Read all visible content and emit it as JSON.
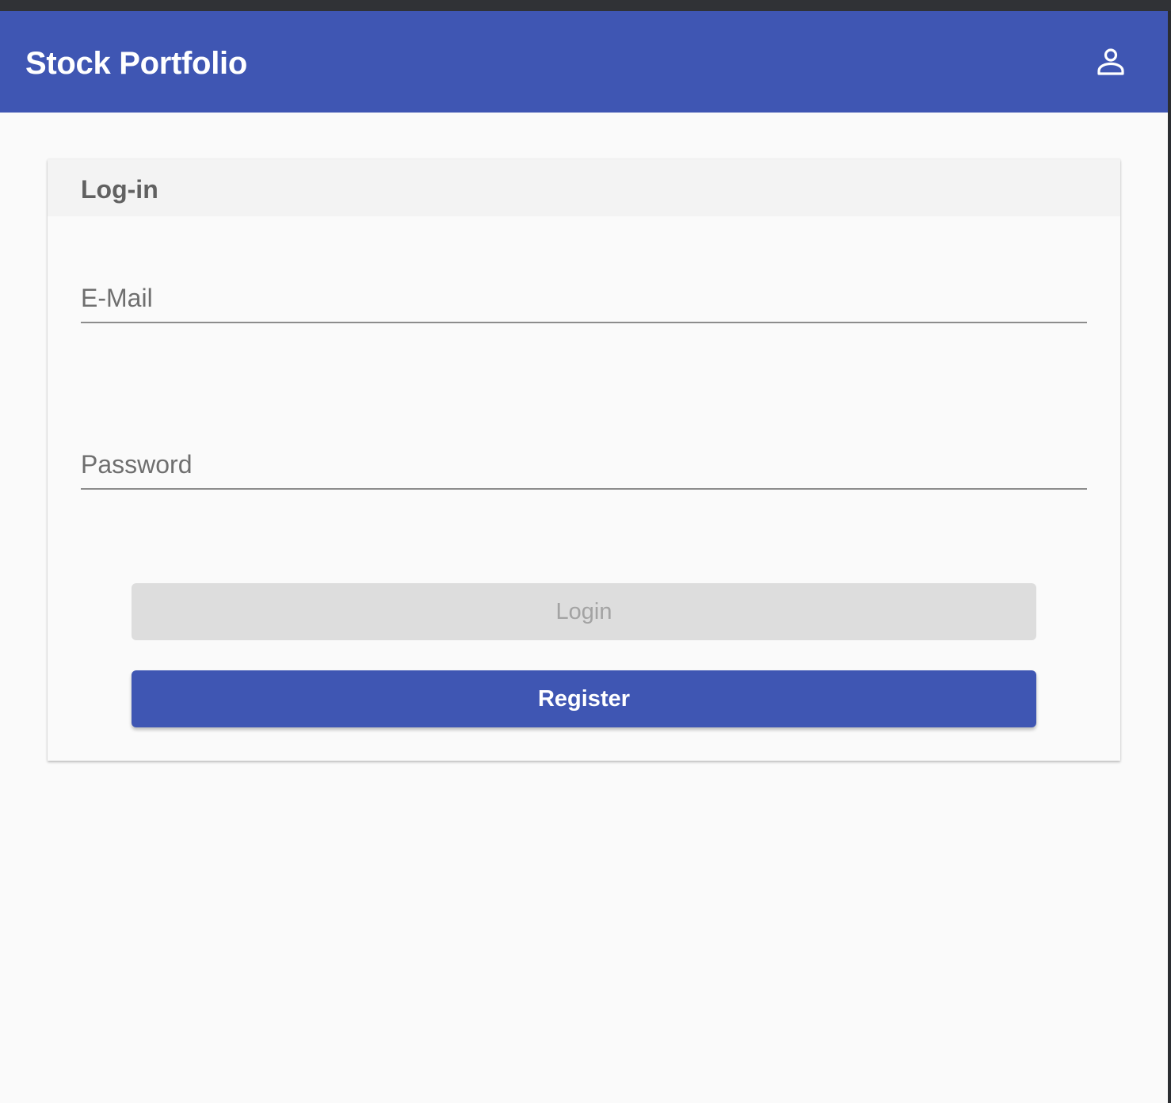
{
  "app": {
    "title": "Stock Portfolio",
    "account_icon": "person-outline-icon"
  },
  "login_card": {
    "title": "Log-in",
    "email": {
      "placeholder": "E-Mail",
      "value": ""
    },
    "password": {
      "placeholder": "Password",
      "value": ""
    },
    "login_label": "Login",
    "login_disabled": true,
    "register_label": "Register"
  },
  "colors": {
    "primary": "#3f56b3",
    "disabled_button": "#dddddd",
    "disabled_text": "#a3a3a3",
    "background": "#fafafa"
  }
}
